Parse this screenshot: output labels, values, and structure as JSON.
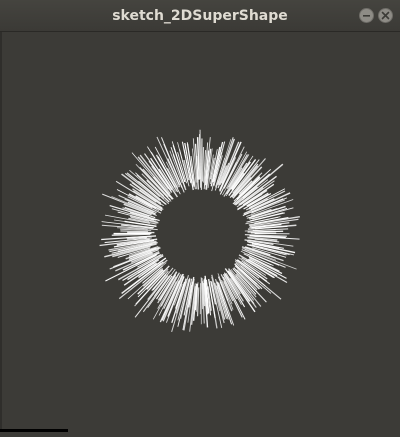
{
  "window": {
    "title": "sketch_2DSuperShape",
    "buttons": {
      "minimize_icon": "minimize-icon",
      "close_icon": "close-icon"
    }
  },
  "colors": {
    "background": "#3c3b37",
    "stroke": "#ffffff",
    "titlebar_text": "#dfdbd2"
  },
  "sketch": {
    "shape": "radial-supershape",
    "spokes": 360
  }
}
